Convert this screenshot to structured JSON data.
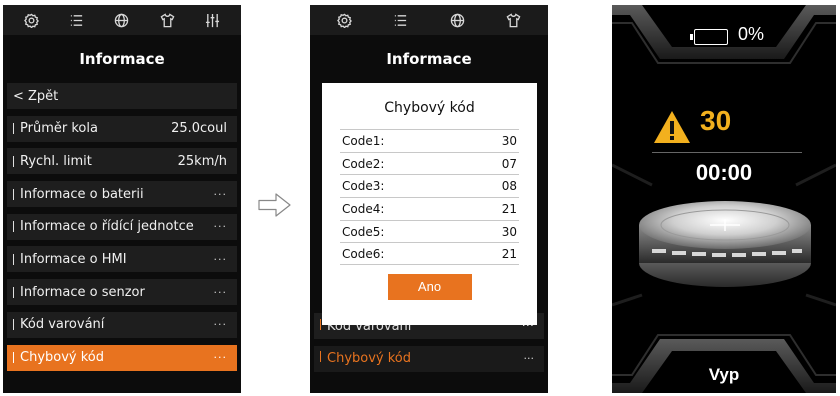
{
  "screen1": {
    "tabs": [
      "settings-icon",
      "list-icon",
      "globe-icon",
      "shirt-icon",
      "sliders-icon"
    ],
    "title": "Informace",
    "back_label": "< Zpět",
    "rows": [
      {
        "label": "Průměr kola",
        "value": "25.0coul"
      },
      {
        "label": "Rychl. limit",
        "value": "25km/h"
      },
      {
        "label": "Informace o baterii",
        "value": "···"
      },
      {
        "label": "Informace o řídící jednotce",
        "value": "···"
      },
      {
        "label": "Informace o HMI",
        "value": "···"
      },
      {
        "label": "Informace o senzor",
        "value": "···"
      },
      {
        "label": "Kód varování",
        "value": "···"
      },
      {
        "label": "Chybový kód",
        "value": "···"
      }
    ],
    "active_color": "#e8731f"
  },
  "screen2": {
    "tabs": [
      "settings-icon",
      "list-icon",
      "globe-icon",
      "shirt-icon"
    ],
    "title": "Informace",
    "bg_rows": [
      {
        "label": "Kód varování",
        "value": "···"
      },
      {
        "label": "Chybový kód",
        "value": "···"
      }
    ],
    "dialog": {
      "title": "Chybový kód",
      "codes": [
        {
          "label": "Code1:",
          "value": "30"
        },
        {
          "label": "Code2:",
          "value": "07"
        },
        {
          "label": "Code3:",
          "value": "08"
        },
        {
          "label": "Code4:",
          "value": "21"
        },
        {
          "label": "Code5:",
          "value": "30"
        },
        {
          "label": "Code6:",
          "value": "21"
        }
      ],
      "ok_label": "Ano"
    }
  },
  "screen3": {
    "battery_pct": "0%",
    "warning_code": "30",
    "timer": "00:00",
    "mode": "Vyp",
    "warning_color": "#f2b01e"
  }
}
